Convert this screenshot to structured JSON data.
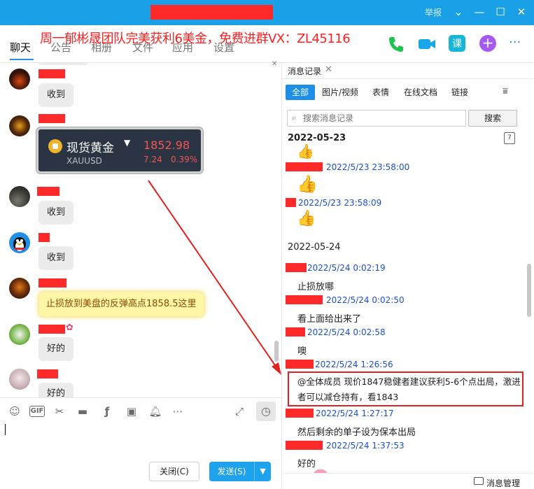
{
  "titlebar": {
    "report_label": "举报",
    "controls": [
      "⌄",
      "—",
      "☐",
      "✕"
    ]
  },
  "banner": {
    "text": "周一郁彬晟团队完美获利6美金，免费进群VX：ZL45116"
  },
  "tabs": [
    {
      "label": "聊天"
    },
    {
      "label": "公告"
    },
    {
      "label": "相册"
    },
    {
      "label": "文件"
    },
    {
      "label": "应用"
    },
    {
      "label": "设置"
    }
  ],
  "top_actions": {
    "phone": "phone-icon",
    "video": "video-icon",
    "class_label": "课",
    "add": "plus-icon",
    "more": "···"
  },
  "chat": {
    "messages": [
      {
        "text": "收到"
      },
      {
        "text": "收到"
      },
      {
        "text": "收到"
      },
      {
        "text": "止损放到美盘的反弹高点1858.5这里"
      },
      {
        "text": "好的"
      },
      {
        "text": "好的"
      }
    ],
    "gold_card": {
      "name": "现货黄金",
      "code": "XAUUSD",
      "price": "1852.98",
      "change": "7.24",
      "percent": "0.39%"
    }
  },
  "input": {
    "close_label": "关闭(C)",
    "send_label": "发送(S)"
  },
  "history": {
    "tab_label": "消息记录",
    "filters": [
      "全部",
      "图片/视频",
      "表情",
      "在线文档",
      "链接"
    ],
    "search_placeholder": "搜索消息记录",
    "search_button": "搜索",
    "calendar_day": "7",
    "dates": [
      "2022-05-23",
      "2022-05-24"
    ],
    "entries": [
      {
        "time": "2022/5/23 23:58:00"
      },
      {
        "time": "2022/5/23 23:58:09"
      },
      {
        "time": "2022/5/24 0:02:19",
        "text": "止损放哪"
      },
      {
        "time": "2022/5/24 0:02:50",
        "text": "看上面给出来了"
      },
      {
        "time": "2022/5/24 0:02:58",
        "text": "噢"
      },
      {
        "time": "2022/5/24 1:26:56",
        "text": "@全体成员 现价1847稳健者建议获利5-6个点出局，激进者可以减仓持有，看1843"
      },
      {
        "time": "2022/5/24 1:27:17",
        "text": "然后剩余的单子设为保本出局"
      },
      {
        "time": "2022/5/24 1:37:53",
        "text": "好的"
      }
    ],
    "footer_label": "消息管理"
  },
  "colors": {
    "titlebar": "#1aa0e6",
    "accent": "#1e8fe6",
    "redaction": "#fe2a2a",
    "banner": "#ff2020",
    "timestamp": "#1a4fd6",
    "highlight": "#e02222"
  }
}
